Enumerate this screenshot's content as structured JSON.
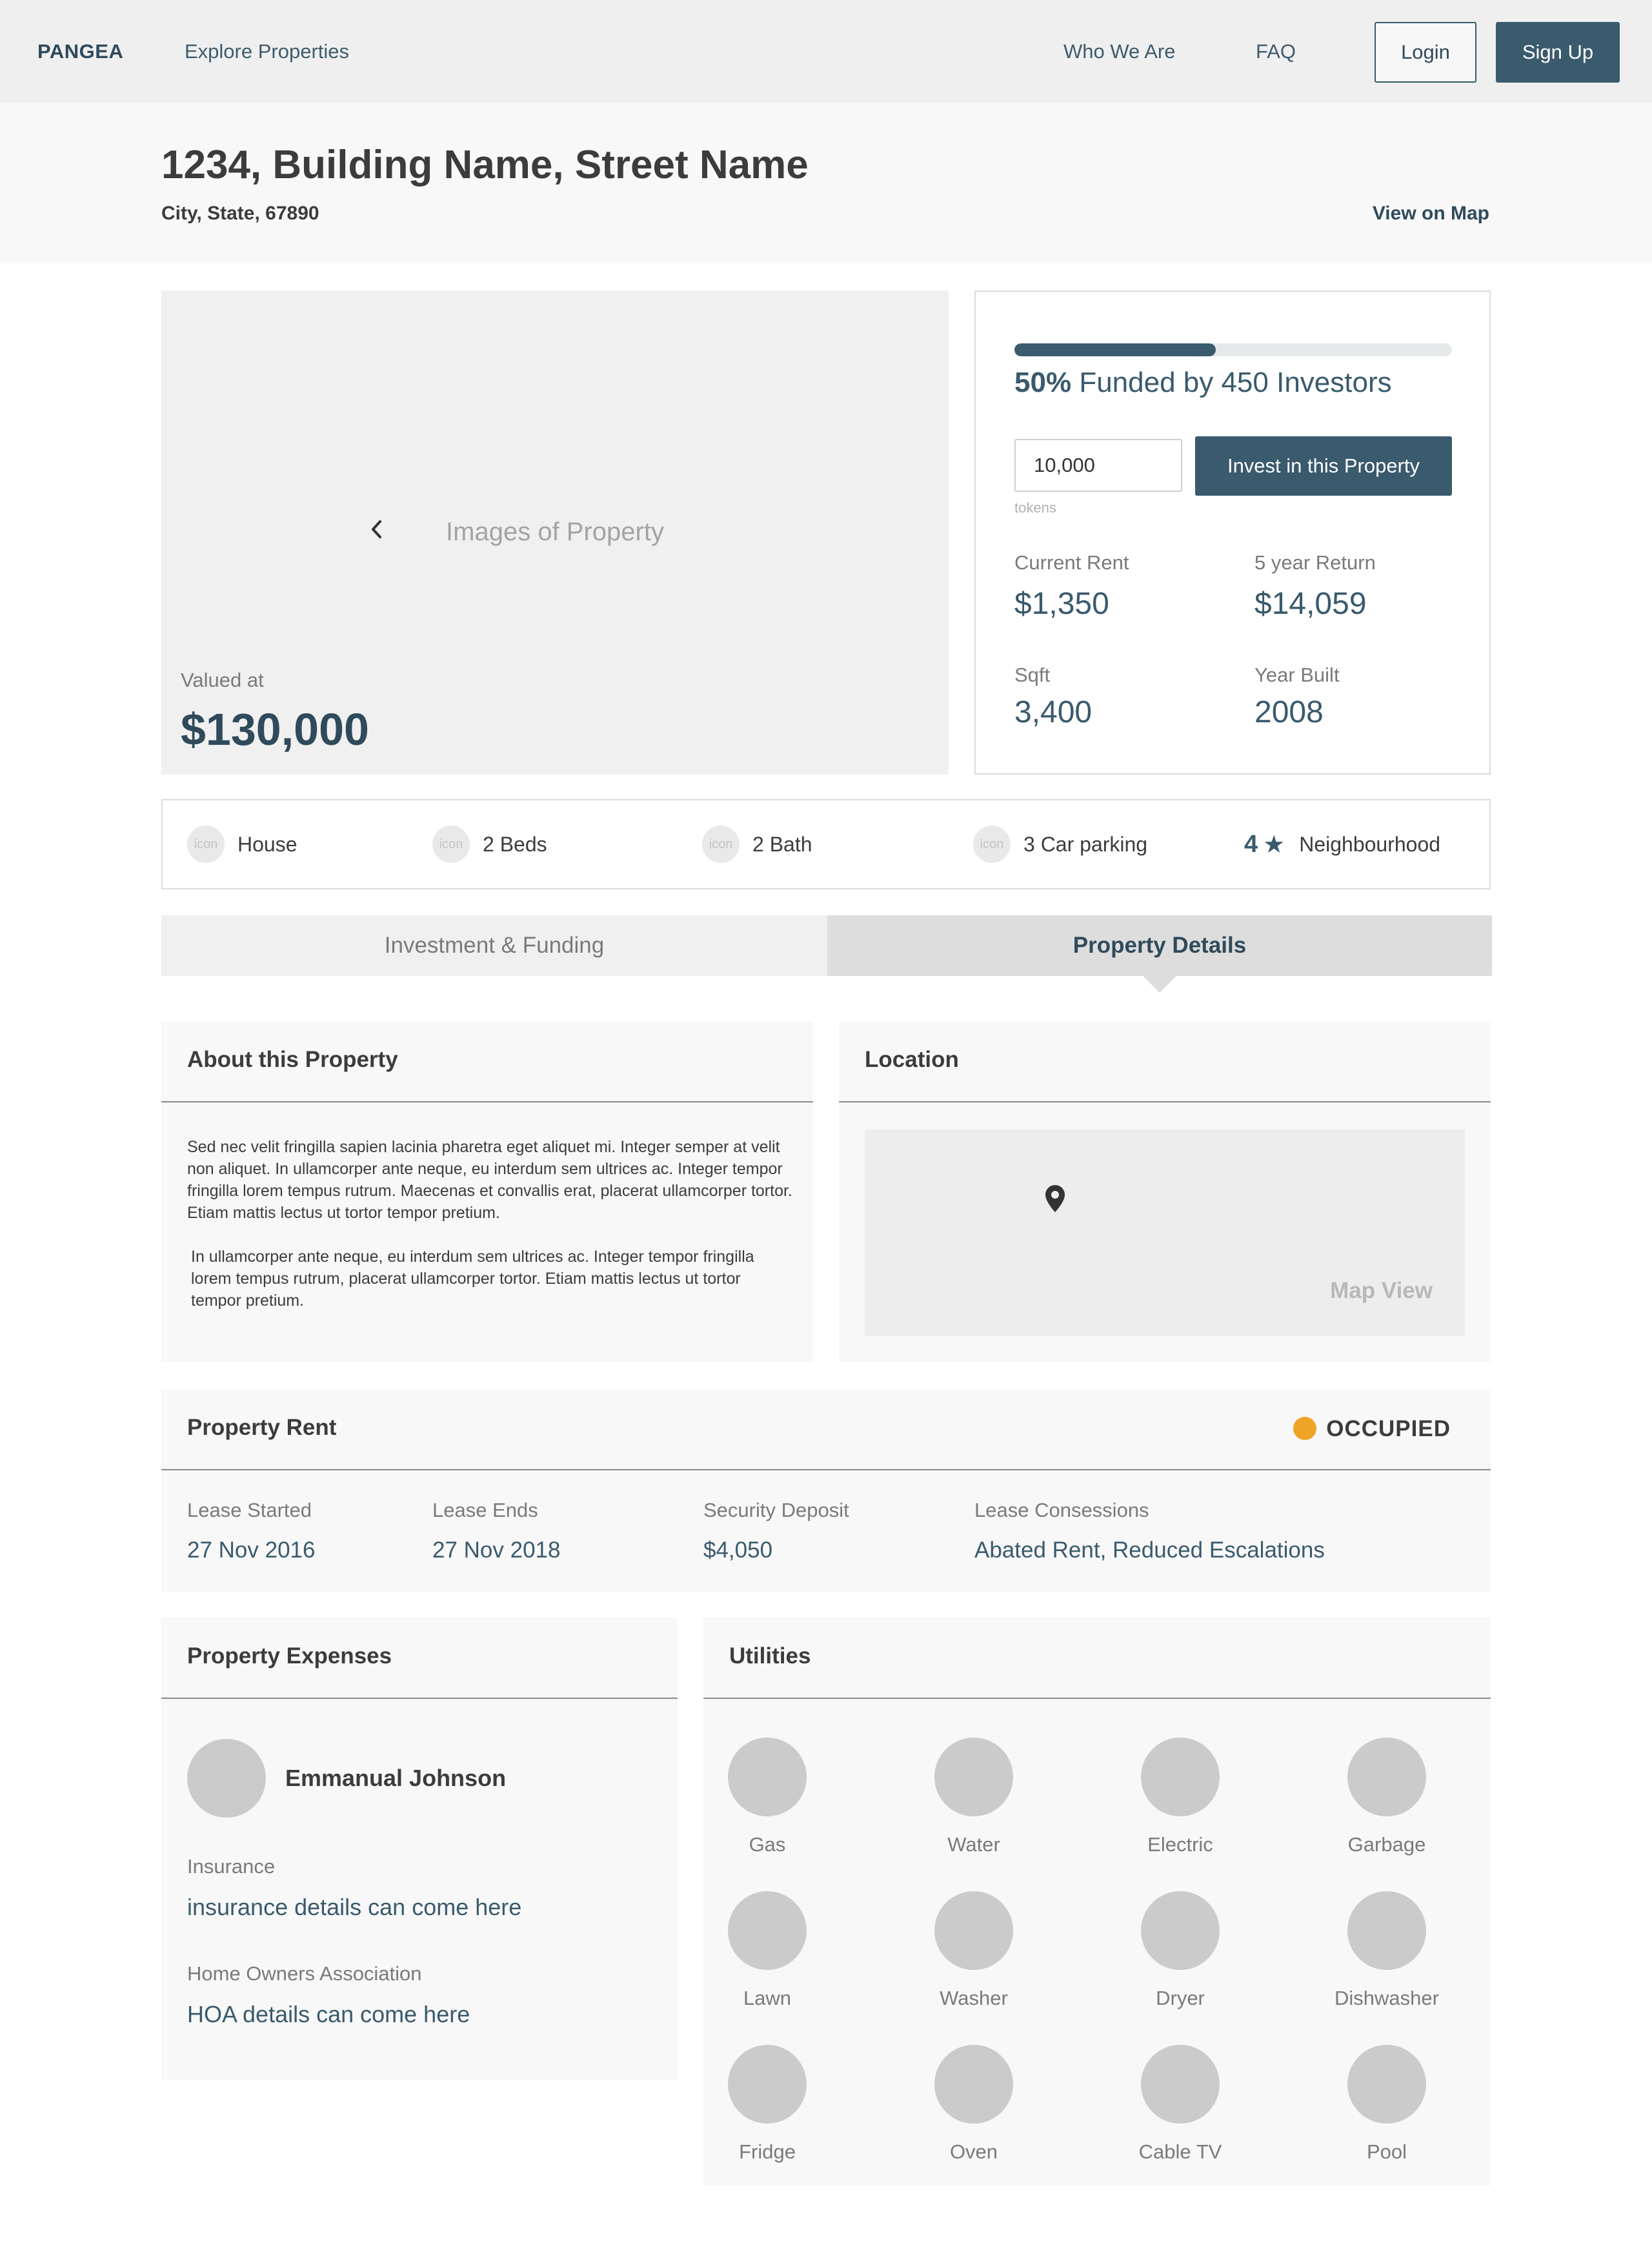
{
  "nav": {
    "brand": "PANGEA",
    "explore": "Explore Properties",
    "who": "Who We Are",
    "faq": "FAQ",
    "login": "Login",
    "signup": "Sign Up"
  },
  "header": {
    "title": "1234, Building Name, Street Name",
    "subtitle": "City, State, 67890",
    "map_link": "View on Map"
  },
  "gallery": {
    "placeholder": "Images of Property",
    "prev_icon": "chevron-left-icon",
    "next_icon": "chevron-right-icon",
    "valued_label": "Valued at",
    "valued_value": "$130,000"
  },
  "funding": {
    "progress_fraction": 0.46,
    "percent": "50%",
    "funded_text": "Funded by 450 Investors",
    "tokens_value": "10,000",
    "tokens_hint": "tokens",
    "invest_label": "Invest in this Property",
    "stats": [
      {
        "label": "Current Rent",
        "value": "$1,350"
      },
      {
        "label": "5 year Return",
        "value": "$14,059"
      },
      {
        "label": "Sqft",
        "value": "3,400"
      },
      {
        "label": "Year Built",
        "value": "2008"
      }
    ]
  },
  "features": {
    "icon_text": "icon",
    "items": [
      "House",
      "2 Beds",
      "2 Bath",
      "3 Car parking"
    ],
    "neighbourhood_score": "4",
    "neighbourhood_label": "Neighbourhood"
  },
  "tabs": {
    "inactive": "Investment & Funding",
    "active": "Property Details"
  },
  "about": {
    "title": "About this Property",
    "para1": "Sed nec velit fringilla sapien lacinia pharetra eget aliquet mi. Integer semper at velit non aliquet. In ullamcorper ante neque, eu interdum sem ultrices ac. Integer tempor fringilla lorem tempus rutrum. Maecenas et convallis erat, placerat ullamcorper tortor. Etiam mattis lectus ut tortor tempor pretium.",
    "para2": "In ullamcorper ante neque, eu interdum sem ultrices ac. Integer tempor fringilla lorem tempus rutrum, placerat ullamcorper tortor. Etiam mattis lectus ut tortor tempor pretium."
  },
  "location": {
    "title": "Location",
    "map_label": "Map View",
    "pin_icon": "map-pin-icon"
  },
  "rent": {
    "title": "Property Rent",
    "status": "OCCUPIED",
    "status_color": "#efa425",
    "items": [
      {
        "label": "Lease Started",
        "value": "27 Nov 2016"
      },
      {
        "label": "Lease Ends",
        "value": "27 Nov 2018"
      },
      {
        "label": "Security Deposit",
        "value": "$4,050"
      },
      {
        "label": "Lease Consessions",
        "value": "Abated Rent, Reduced Escalations"
      }
    ]
  },
  "expenses": {
    "title": "Property Expenses",
    "person": "Emmanual Johnson",
    "insurance_label": "Insurance",
    "insurance_value": "insurance details can come here",
    "hoa_label": "Home Owners Association",
    "hoa_value": "HOA details can come here"
  },
  "utilities": {
    "title": "Utilities",
    "items": [
      "Gas",
      "Water",
      "Electric",
      "Garbage",
      "Lawn",
      "Washer",
      "Dryer",
      "Dishwasher",
      "Fridge",
      "Oven",
      "Cable TV",
      "Pool"
    ]
  },
  "colors": {
    "accent": "#3a5a6d",
    "nav_bg": "#efefef",
    "card_bg": "#f8f8f8"
  }
}
